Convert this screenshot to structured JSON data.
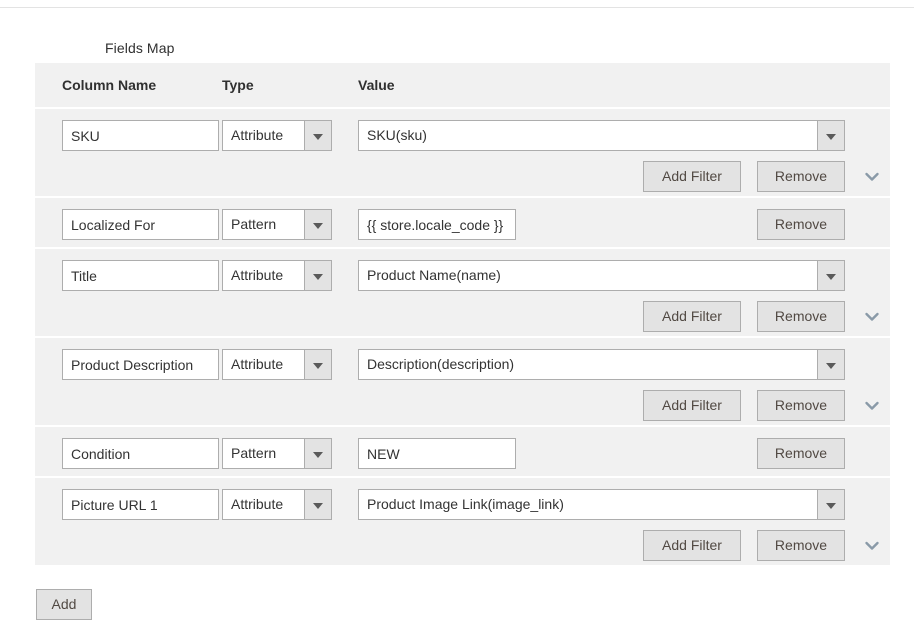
{
  "section": {
    "label": "Fields Map"
  },
  "table": {
    "headers": {
      "column_name": "Column Name",
      "type": "Type",
      "value": "Value"
    },
    "rows": [
      {
        "column_name": "SKU",
        "type": "Attribute",
        "value": "SKU(sku)",
        "value_kind": "select",
        "add_filter_label": "Add Filter",
        "remove_label": "Remove",
        "has_expander": true
      },
      {
        "column_name": "Localized For",
        "type": "Pattern",
        "value": "{{ store.locale_code }}",
        "value_kind": "text",
        "remove_label": "Remove",
        "has_expander": false
      },
      {
        "column_name": "Title",
        "type": "Attribute",
        "value": "Product Name(name)",
        "value_kind": "select",
        "add_filter_label": "Add Filter",
        "remove_label": "Remove",
        "has_expander": true
      },
      {
        "column_name": "Product Description",
        "type": "Attribute",
        "value": "Description(description)",
        "value_kind": "select",
        "add_filter_label": "Add Filter",
        "remove_label": "Remove",
        "has_expander": true
      },
      {
        "column_name": "Condition",
        "type": "Pattern",
        "value": "NEW",
        "value_kind": "text",
        "remove_label": "Remove",
        "has_expander": false
      },
      {
        "column_name": "Picture URL 1",
        "type": "Attribute",
        "value": "Product Image Link(image_link)",
        "value_kind": "select",
        "add_filter_label": "Add Filter",
        "remove_label": "Remove",
        "has_expander": true
      }
    ]
  },
  "footer": {
    "add_label": "Add"
  },
  "icons": {
    "dropdown_arrow": "caret-down-icon",
    "expander": "chevron-down-icon"
  },
  "colors": {
    "row_background": "#f1f1f1",
    "header_background": "#f1f1f1",
    "button_background": "#e3e3e3",
    "border": "#adadad",
    "text": "#303030",
    "button_text": "#514943",
    "chevron": "#8a9aa8"
  }
}
